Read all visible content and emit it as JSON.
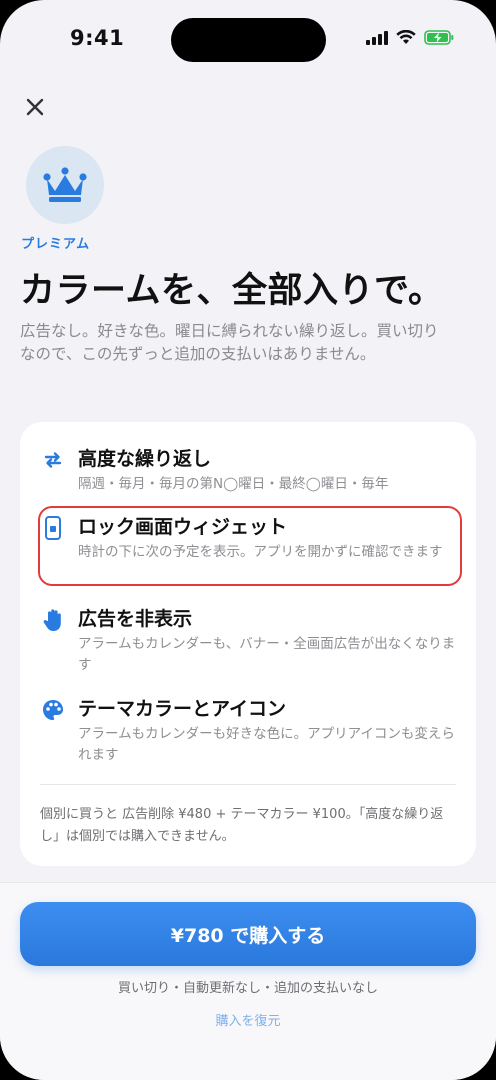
{
  "status_bar": {
    "time": "9:41"
  },
  "header": {
    "premium_label": "プレミアム",
    "headline": "カラームを、全部入りで。",
    "subtext": "広告なし。好きな色。曜日に縛られない繰り返し。買い切りなので、この先ずっと追加の支払いはありません。"
  },
  "features": [
    {
      "icon": "repeat-icon",
      "title": "高度な繰り返し",
      "desc": "隔週・毎月・毎月の第N◯曜日・最終◯曜日・毎年"
    },
    {
      "icon": "lock-widget-icon",
      "title": "ロック画面ウィジェット",
      "desc": "時計の下に次の予定を表示。アプリを開かずに確認できます"
    },
    {
      "icon": "hand-icon",
      "title": "広告を非表示",
      "desc": "アラームもカレンダーも、バナー・全画面広告が出なくなります"
    },
    {
      "icon": "palette-icon",
      "title": "テーマカラーとアイコン",
      "desc": "アラームもカレンダーも好きな色に。アプリアイコンも変えられます"
    }
  ],
  "footnote": "個別に買うと 広告削除 ¥480 + テーマカラー ¥100。「高度な繰り返し」は個別では購入できません。",
  "purchase": {
    "button_label": "¥780 で購入する",
    "note": "買い切り・自動更新なし・追加の支払いなし",
    "restore_label": "購入を復元"
  },
  "colors": {
    "accent": "#2a7be0",
    "highlight_border": "#e23b3b",
    "background": "#f2f2f7"
  }
}
